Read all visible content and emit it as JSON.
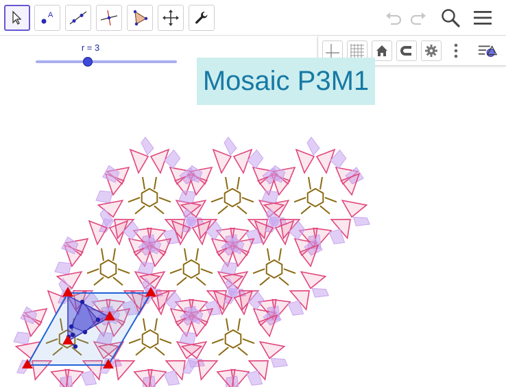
{
  "toolbar": {
    "tools": [
      {
        "name": "move-tool",
        "icon": "arrow-cursor-icon"
      },
      {
        "name": "point-tool",
        "icon": "point-A-icon",
        "glyph": "A"
      },
      {
        "name": "line-tool",
        "icon": "line-through-points-icon"
      },
      {
        "name": "perpendicular-tool",
        "icon": "perpendicular-line-icon"
      },
      {
        "name": "polygon-tool",
        "icon": "polygon-icon"
      },
      {
        "name": "move-graphics-tool",
        "icon": "move-graphics-icon"
      },
      {
        "name": "tools-menu",
        "icon": "wrench-icon"
      }
    ],
    "right": [
      "undo-icon",
      "redo-icon",
      "search-icon",
      "menu-icon"
    ]
  },
  "graphics_bar": [
    "axes-icon",
    "grid-icon",
    "home-icon",
    "magnet-icon",
    "gear-icon",
    "more-vertical-icon",
    "style-bar-toggle-icon"
  ],
  "slider": {
    "label": "r = 3",
    "value": 3
  },
  "title": "Mosaic P3M1",
  "colors": {
    "accent": "#6557d2",
    "title_bg": "#cdeeee",
    "title_text": "#1679a5",
    "pink": "#e0457d",
    "lilac": "#c9a6ef",
    "brown": "#8a6a12",
    "parallelogram": "#1f63d8",
    "vertex": "#e00000",
    "triangle": "#5a59d6",
    "point": "#1d1fa8"
  }
}
